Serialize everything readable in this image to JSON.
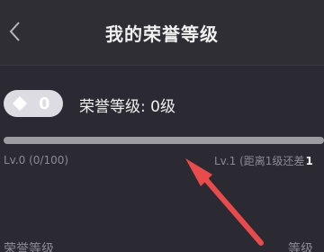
{
  "header": {
    "title": "我的荣誉等级",
    "back_icon": "chevron-left-icon"
  },
  "honor_card": {
    "badge_value": "0",
    "badge_icon": "diamond-icon",
    "level_text": "荣誉等级: 0级",
    "progress": 0,
    "left_caption": "Lv.0 (0/100)",
    "right_caption": "Lv.1 (距离1级还差",
    "right_caption_number": "1"
  },
  "section_header": {
    "left": "荣誉等级",
    "right": "等级"
  },
  "annotation": {
    "arrow_color": "#e84b4b"
  }
}
